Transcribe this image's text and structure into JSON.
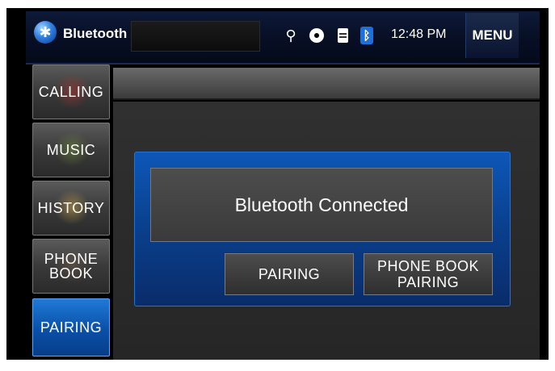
{
  "header": {
    "title": "Bluetooth",
    "time": "12:48 PM",
    "menu_label": "MENU",
    "status_icons": [
      "usb-icon",
      "disc-icon",
      "sd-card-icon",
      "bluetooth-icon"
    ]
  },
  "sidebar": {
    "items": [
      {
        "label": "CALLING",
        "icon": "phone-icon"
      },
      {
        "label": "MUSIC",
        "icon": "music-icon"
      },
      {
        "label": "HISTORY",
        "icon": "clock-icon"
      },
      {
        "label": "PHONE BOOK",
        "line1": "PHONE",
        "line2": "BOOK",
        "icon": "phonebook-icon"
      },
      {
        "label": "PAIRING",
        "active": true
      }
    ]
  },
  "dialog": {
    "message": "Bluetooth Connected",
    "pairing_label": "PAIRING",
    "phonebook_pairing_line1": "PHONE BOOK",
    "phonebook_pairing_line2": "PAIRING"
  },
  "colors": {
    "accent": "#0a4fa8",
    "bar": "#081027"
  }
}
